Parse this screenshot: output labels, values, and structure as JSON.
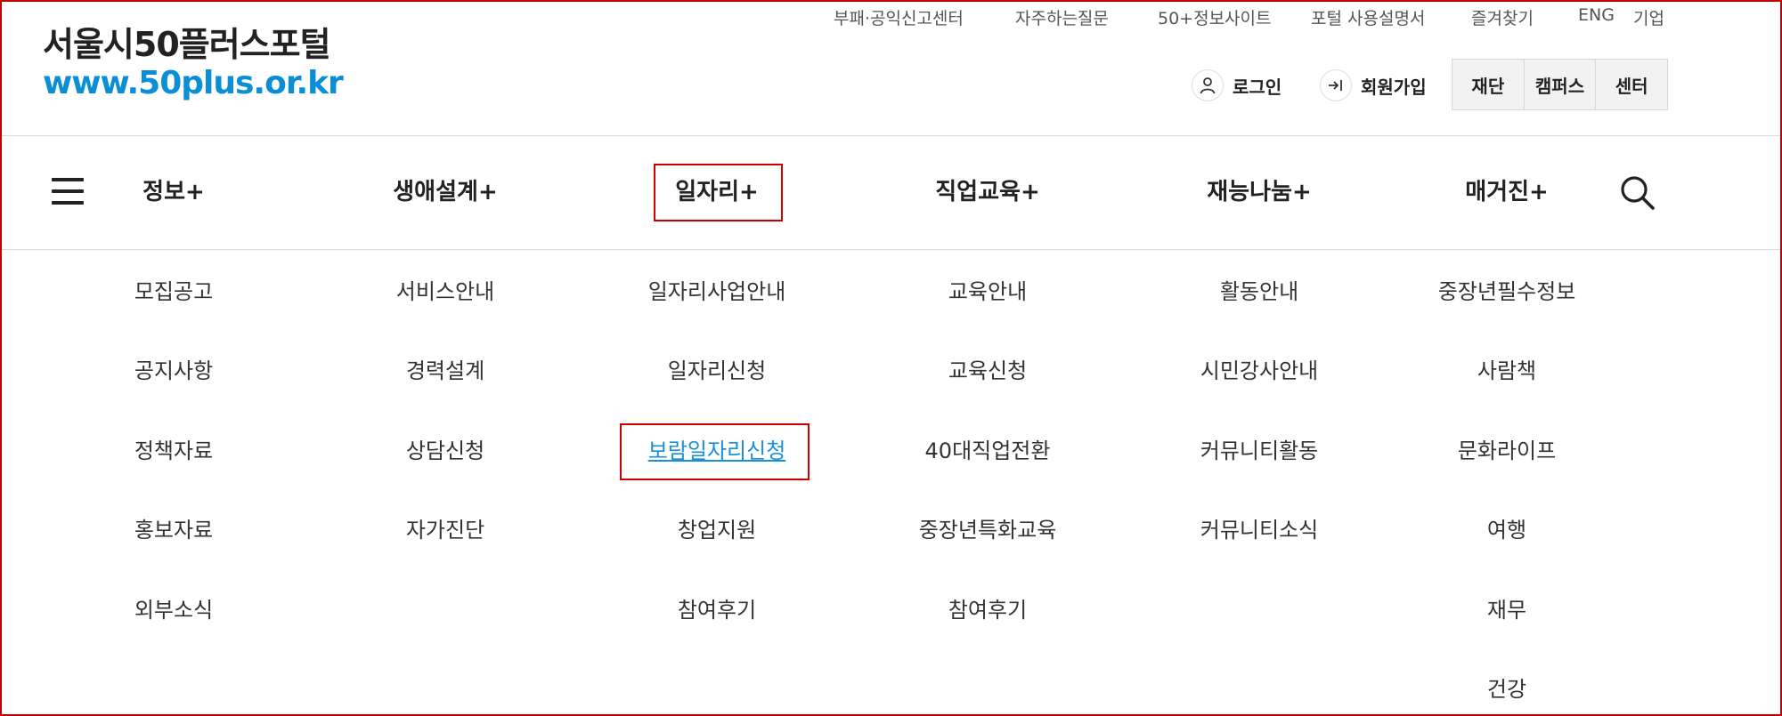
{
  "logo": {
    "title": "서울시50플러스포털",
    "url": "www.50plus.or.kr"
  },
  "top_links": [
    "부패·공익신고센터",
    "자주하는질문",
    "50+정보사이트",
    "포털 사용설명서",
    "즐겨찾기",
    "ENG",
    "기업"
  ],
  "auth": {
    "login": "로그인",
    "signup": "회원가입"
  },
  "org_tabs": [
    "재단",
    "캠퍼스",
    "센터"
  ],
  "nav": [
    "정보+",
    "생애설계+",
    "일자리+",
    "직업교육+",
    "재능나눔+",
    "매거진+"
  ],
  "submenu": [
    [
      "모집공고",
      "공지사항",
      "정책자료",
      "홍보자료",
      "외부소식"
    ],
    [
      "서비스안내",
      "경력설계",
      "상담신청",
      "자가진단"
    ],
    [
      "일자리사업안내",
      "일자리신청",
      "보람일자리신청",
      "창업지원",
      "참여후기"
    ],
    [
      "교육안내",
      "교육신청",
      "40대직업전환",
      "중장년특화교육",
      "참여후기"
    ],
    [
      "활동안내",
      "시민강사안내",
      "커뮤니티활동",
      "커뮤니티소식"
    ],
    [
      "중장년필수정보",
      "사람책",
      "문화라이프",
      "여행",
      "재무",
      "건강"
    ]
  ],
  "colors": {
    "accent_blue": "#0a8fd6",
    "highlight_red": "#d10000"
  }
}
